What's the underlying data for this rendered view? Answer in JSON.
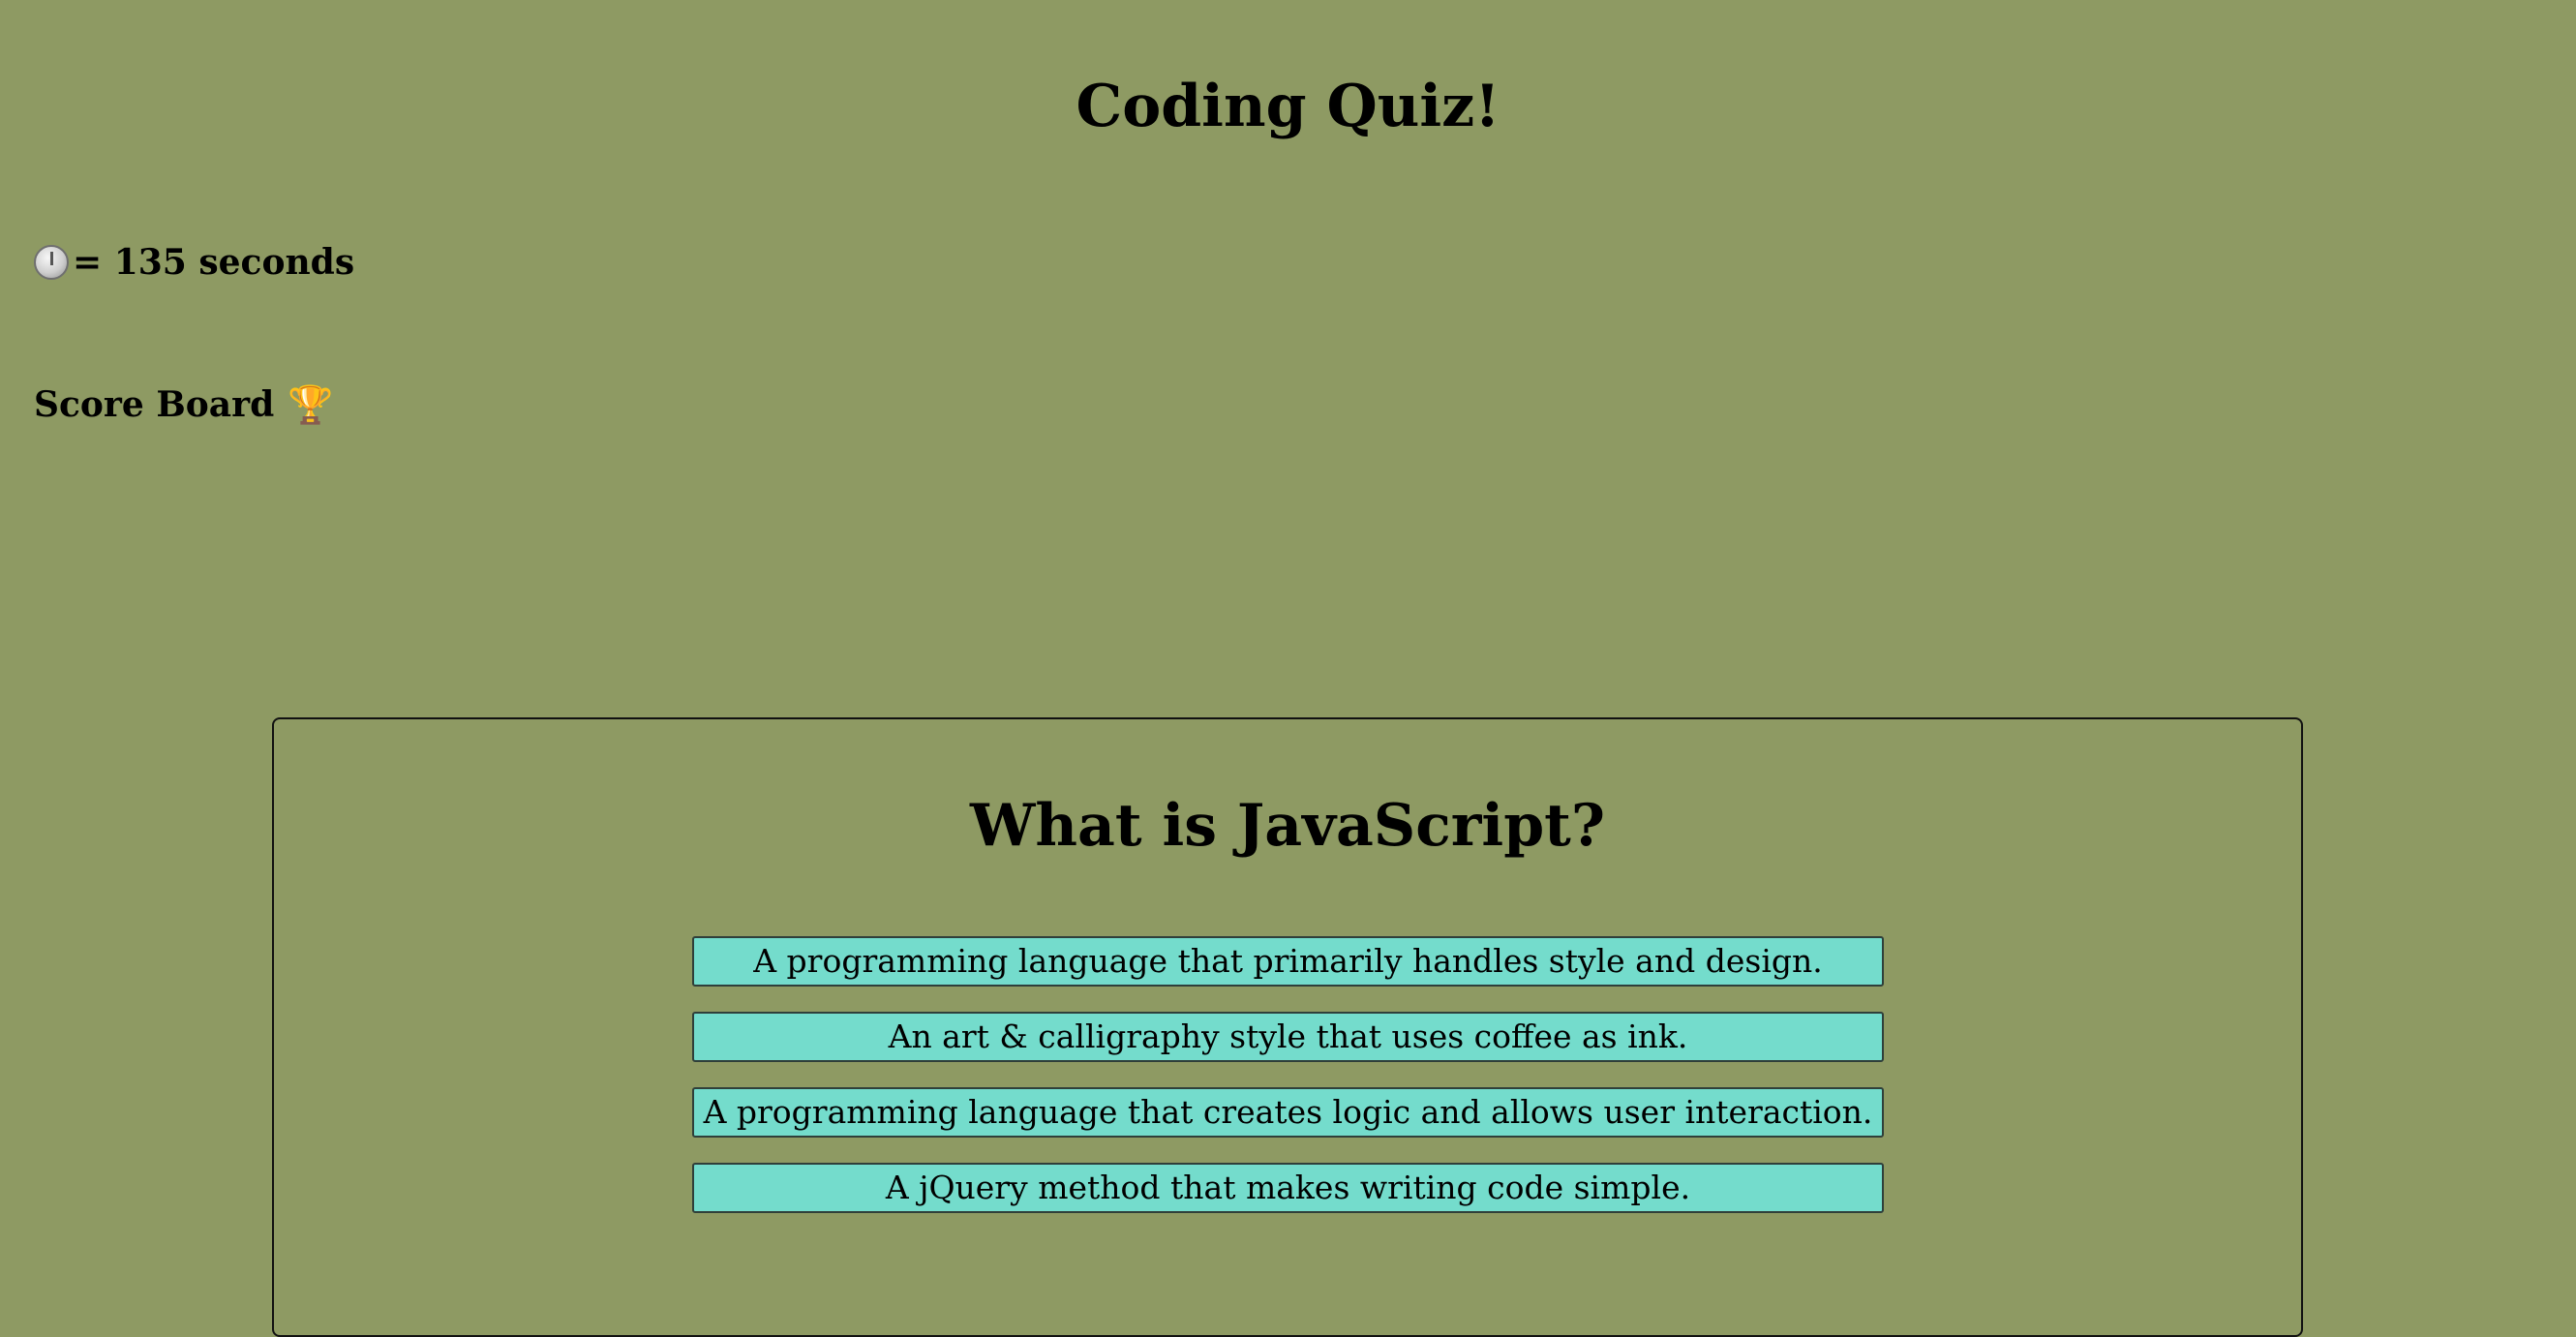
{
  "header": {
    "title": "Coding Quiz!"
  },
  "timer": {
    "icon": "stopwatch-icon",
    "text": "= 135 seconds"
  },
  "score_board": {
    "label": "Score Board",
    "icon": "trophy-icon",
    "icon_glyph": "🏆"
  },
  "quiz": {
    "question": "What is JavaScript?",
    "choices": [
      "A programming language that primarily handles style and design.",
      "An art & calligraphy style that uses coffee as ink.",
      "A programming language that creates logic and allows user interaction.",
      "A jQuery method that makes writing code simple."
    ]
  },
  "colors": {
    "background": "#8e9a63",
    "choice_background": "#74dccc"
  }
}
